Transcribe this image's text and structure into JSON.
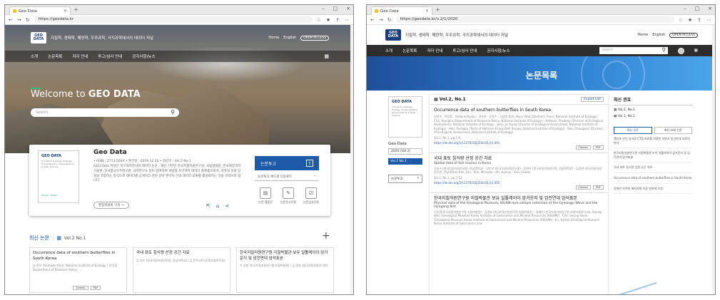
{
  "left": {
    "browser": {
      "tab_title": "Geo Data",
      "url": "https://geodata.kr"
    },
    "header": {
      "logo_top": "GEO",
      "logo_bottom": "DATA",
      "tagline": "지질학, 생태학, 해양학, 우주과학, 극지과학에서의 데이터 저널",
      "home": "Home",
      "english": "English",
      "open_access": "OPEN ACCESS"
    },
    "nav": [
      "소개",
      "논문목록",
      "저자 안내",
      "투고/심사 안내",
      "공지사항/뉴스"
    ],
    "hero": {
      "welcome_prefix": "Welcome to",
      "welcome_strong": "GEO DATA",
      "search_placeholder": "Search"
    },
    "journal": {
      "cover_title": "GEO DATA",
      "cover_sub": "Journal for Geology, Ecology, Oceanography, Space Science & Polar Science",
      "cover_footer": "KIGAM · KOPRI",
      "name": "Geo Data",
      "meta": "• ISSN : 2713-5004  • 발간일 : 2019.12.30  • 최신호 : Vol.2 No.1",
      "desc": "GEO Data 저널은 지구과학분야의 데이터 논문 · 생산 기관인 한국지질자원연구원, 국립생태원, 한국해양과학기술원, 한국항공우주연구원, 극지연구소 등이 참여하여 개방형 지구과학 데이터 플랫폼으로서, 과학적 목표 달성을 포함하는 방식으로 데이터를 공개하고 관련 분야 연구자 간의 데이터 교류를 활성화하는 것을 목적으로 합니다.",
      "button": "편집위원회 구성 →",
      "submit": "논문투고",
      "dropdown": "논문투고 애드원 다운로드",
      "tiles": [
        "논문 템플릿",
        "논문투고규정",
        "논문심사규정"
      ]
    },
    "latest": {
      "heading": "최신 논문",
      "volume": "Vol.2 No.1"
    },
    "items": [
      {
        "title": "Occurrence data of southern butterflies in South Korea",
        "authors": "김 현우 (Youhwan Kim), National Institute of Ecology / 곽 정훈 Department of Research Policy, ..."
      },
      {
        "title": "국내 표토 침식량 산정 공간 자료",
        "authors": "김 지수 (한국지질자원연구원, 전남대학교) / 김 민석 (한국지질자원연구원) ..."
      },
      {
        "title": "한국지질자원연구원 지질박물관 보유 일툴레이아 암거운지 및 암전연대 암석표본",
        "authors": "이 승원 (한국지질자원연구원 지질박물관) / 김 명호 (한국지질자원연구원) ..."
      }
    ],
    "buttons": {
      "citation": "Citation",
      "pdf": "PDF"
    }
  },
  "right": {
    "browser": {
      "tab_title": "Geo Data",
      "url": "https://geodata.kr/v.2/1/2020"
    },
    "header": {
      "logo_top": "GEO",
      "logo_bottom": "DATA",
      "tagline": "지질학, 생태학, 해양학, 우주과학, 극지과학에서의 데이터 저널",
      "home": "Home",
      "english": "English",
      "open_access": "OPEN ACCESS"
    },
    "nav": [
      "소개",
      "논문목록",
      "저자 안내",
      "투고/심사 안내",
      "공지사항/뉴스"
    ],
    "search_placeholder": "Search",
    "banner_title": "논문목록",
    "leftcol": {
      "title": "Geo Data",
      "year": "2020 (Vol.2)",
      "vol": "Vol.2 No.1",
      "submit": "논문투고"
    },
    "main": {
      "heading": "Vol.2, No.1",
      "export": "Export List",
      "articles": [
        {
          "title": "Occurrence data of southern butterflies in South Korea",
          "en": "",
          "authors": "김현우 · 곽정훈 · Ashikunihyoon · 권우현 · 장동수 · 서영호 Kim, Hyun Woo (Southern Team, National Institute of Ecology) · Cho, Youngho (Department of Research Policy, National Institute of Ecology) · Adhikari, Pradeep (Division of Ecological Assessment, National Institute of Ecology) · Jeon, Ja Young (Division of Ecological Assessment, National Institute of Ecology) · Han, Youngsu (Team of National Ecosystem Survey, National Institute of Ecology) · Seo, Changwan (Division of Ecological Assessment, National Institute of Ecology)",
          "pages": "Vol.2, No.1, pp.1-8",
          "doi": "https://dx.doi.org/10.22761/DJ2020.01.01.001"
        },
        {
          "title": "국내 표토 침식량 산정 공간 자료",
          "en": "Spatial data of Soil erosion in Korea",
          "authors": "김지수 (한국지질자원연구원, 전남대학교) · 김민석 (한국지질자원연구원) · 송현아 (한국지질자원연구원, 전남대학교) · 김강관 (한국지질자원연구원, 전남대학교) Kim, Jisu · Kim, Minseok · Oh, Hyunju · Kim, Jinwoo",
          "pages": "Vol.2, No.1, pp.7-12",
          "doi": "https://dx.doi.org/10.22761/DJ2020.01.01.002"
        },
        {
          "title": "한국지질자원연구원 지질박물관 보유 일툴레이아 암거운지 및 암전연대 암석표본",
          "en": "Physical data of the Geological Museum, KIGAM rock sample collection of the Gyeongju Wave and the Injingang Belt",
          "authors": "이승원(한국지질자원연구원 지질박물관) · 김명호 (한국지질자원연구원 지질박물관) · 정혜원 (한국지질자원연구원 지질박물관) Lee, Seung-Won (Geological Museum Korea Institute of Geoscience and Mineral Resources (KIGAM)) · Cho, Seung-hwan (Geological Museum Korea Institute of Geoscience and Mineral Resources (KIGAM)) · Jin, Hyeon (Geological Museum Korea Institute of Geoscience and",
          "pages": "",
          "doi": ""
        }
      ],
      "citation": "Citation",
      "pdf": "PDF"
    },
    "side": {
      "heading": "최신 권호",
      "vols": [
        "Vol.2, No.1",
        "Vol.1, No.1"
      ],
      "tabs": [
        "최신 논문",
        "최다 조회 논문"
      ],
      "list": [
        "캘리포 산단 농어류 CTD 자료를 이용한 자연서 동산만대 자료의 분석",
        "한국지질자원연구원 지질박물관 보유 일툴레이아 암거운지 및 암전연대 암석표본",
        "국내 표토 침식량 산정 공간 자료",
        "Occurrence data of southern butterflies in South Korea",
        "동해안 유역의 해저지형 자료 방파제 조정"
      ]
    }
  }
}
